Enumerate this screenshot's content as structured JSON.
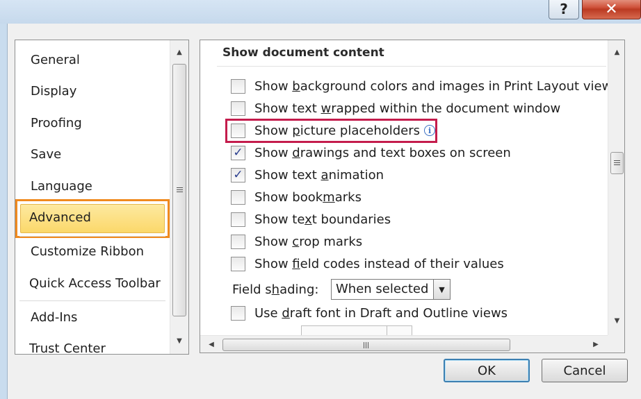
{
  "titlebar": {
    "help_label": "?",
    "close_label": "✕"
  },
  "nav": {
    "items": [
      {
        "label": "General"
      },
      {
        "label": "Display"
      },
      {
        "label": "Proofing"
      },
      {
        "label": "Save"
      },
      {
        "label": "Language"
      },
      {
        "label": "Advanced",
        "selected": true
      },
      {
        "label": "Customize Ribbon"
      },
      {
        "label": "Quick Access Toolbar"
      },
      {
        "label": "Add-Ins"
      },
      {
        "label": "Trust Center"
      }
    ]
  },
  "panel": {
    "section_title": "Show document content",
    "options": [
      {
        "pre": "Show ",
        "key": "b",
        "post": "ackground colors and images in Print Layout view",
        "checked": false
      },
      {
        "pre": "Show text ",
        "key": "w",
        "post": "rapped within the document window",
        "checked": false
      },
      {
        "pre": "Show ",
        "key": "p",
        "post": "icture placeholders",
        "checked": false,
        "info": true
      },
      {
        "pre": "Show ",
        "key": "d",
        "post": "rawings and text boxes on screen",
        "checked": true
      },
      {
        "pre": "Show text ",
        "key": "a",
        "post": "nimation",
        "checked": true
      },
      {
        "pre": "Show book",
        "key": "m",
        "post": "arks",
        "checked": false
      },
      {
        "pre": "Show te",
        "key": "x",
        "post": "t boundaries",
        "checked": false
      },
      {
        "pre": "Show ",
        "key": "c",
        "post": "rop marks",
        "checked": false
      },
      {
        "pre": "Show ",
        "key": "f",
        "post": "ield codes instead of their values",
        "checked": false
      }
    ],
    "field_shading": {
      "pre": "Field s",
      "key": "h",
      "post": "ading:",
      "value": "When selected"
    },
    "draft_font": {
      "pre": "Use ",
      "key": "d",
      "post": "raft font in Draft and Outline views",
      "checked": false
    },
    "check_mark": "✓",
    "info_glyph": "i"
  },
  "buttons": {
    "ok": "OK",
    "cancel": "Cancel"
  },
  "glyphs": {
    "up": "▲",
    "down": "▼",
    "left": "◀",
    "right": "▶",
    "combo_down": "▼"
  }
}
